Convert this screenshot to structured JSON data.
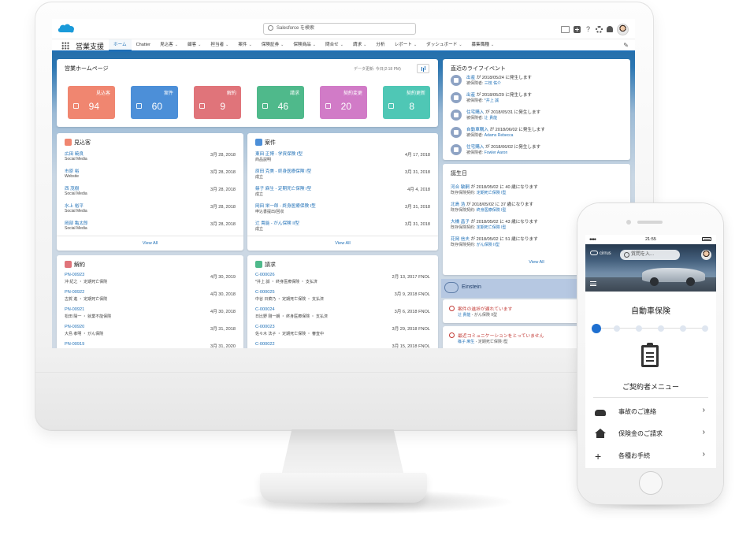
{
  "topbar": {
    "search_placeholder": "Salesforce を検索"
  },
  "nav": {
    "app_name": "営業支援",
    "items": [
      {
        "label": "ホーム",
        "active": true,
        "chevron": false
      },
      {
        "label": "Chatter",
        "active": false,
        "chevron": false
      },
      {
        "label": "見込客",
        "active": false,
        "chevron": true
      },
      {
        "label": "顧客",
        "active": false,
        "chevron": true
      },
      {
        "label": "担当者",
        "active": false,
        "chevron": true
      },
      {
        "label": "案件",
        "active": false,
        "chevron": true
      },
      {
        "label": "保険証券",
        "active": false,
        "chevron": true
      },
      {
        "label": "保険商品",
        "active": false,
        "chevron": true
      },
      {
        "label": "問合せ",
        "active": false,
        "chevron": true
      },
      {
        "label": "請求",
        "active": false,
        "chevron": true
      },
      {
        "label": "分析",
        "active": false,
        "chevron": false
      },
      {
        "label": "レポート",
        "active": false,
        "chevron": true
      },
      {
        "label": "ダッシュボード",
        "active": false,
        "chevron": true
      },
      {
        "label": "募集職種",
        "active": false,
        "chevron": true
      }
    ]
  },
  "home": {
    "title": "営業ホームページ",
    "refresh": "データ更新: 今日(2:18 PM)",
    "tiles": [
      {
        "label": "見込客",
        "value": "94",
        "color": "#f08670"
      },
      {
        "label": "案件",
        "value": "60",
        "color": "#4c8fd8"
      },
      {
        "label": "解約",
        "value": "9",
        "color": "#e0747a"
      },
      {
        "label": "請求",
        "value": "46",
        "color": "#4fb98b"
      },
      {
        "label": "契約変更",
        "value": "20",
        "color": "#d17bc7"
      },
      {
        "label": "契約更新",
        "value": "8",
        "color": "#4fc7b5"
      }
    ]
  },
  "leads": {
    "title": "見込客",
    "icon_color": "#f08670",
    "rows": [
      {
        "name": "広田 暁良",
        "sub": "Social Media",
        "date": "3月 28, 2018"
      },
      {
        "name": "市原 裕",
        "sub": "Website",
        "date": "3月 28, 2018"
      },
      {
        "name": "西 茂樹",
        "sub": "Social Media",
        "date": "3月 28, 2018"
      },
      {
        "name": "水上 裕平",
        "sub": "Social Media",
        "date": "3月 28, 2018"
      },
      {
        "name": "岡部 亀太郎",
        "sub": "Social Media",
        "date": "3月 28, 2018"
      }
    ],
    "view_all": "View All"
  },
  "opps": {
    "title": "案件",
    "icon_color": "#4c8fd8",
    "rows": [
      {
        "name": "東田 正博 - 学資保険 I型",
        "sub": "商品説明",
        "date": "4月 17, 2018"
      },
      {
        "name": "原田 克美 - 終身医療保険 I型",
        "sub": "成立",
        "date": "3月 31, 2018"
      },
      {
        "name": "篠子 麻生 - 定期死亡保険 I型",
        "sub": "成立",
        "date": "4月 4, 2018"
      },
      {
        "name": "岡田 栄一郎 - 終身医療保険 I型",
        "sub": "申込書提出/回収",
        "date": "3月 31, 2018"
      },
      {
        "name": "辻 貴能 - がん保険 II型",
        "sub": "成立",
        "date": "3月 31, 2018"
      }
    ],
    "view_all": "View All"
  },
  "cancels": {
    "title": "解約",
    "icon_color": "#e0747a",
    "rows": [
      {
        "name": "PN-00923",
        "sub": "沖 紀之 ・ 定期死亡保険",
        "date": "4月 30, 2019"
      },
      {
        "name": "PN-00922",
        "sub": "古賀 進 ・ 定期死亡保険",
        "date": "4月 30, 2018"
      },
      {
        "name": "PN-00921",
        "sub": "松田 陽一 ・ 就業不能保険",
        "date": "4月 30, 2018"
      },
      {
        "name": "PN-00920",
        "sub": "大島 孝明 ・ がん保険",
        "date": "3月 31, 2018"
      },
      {
        "name": "PN-00919",
        "sub": "",
        "date": "3月 31, 2020"
      }
    ]
  },
  "claims": {
    "title": "請求",
    "icon_color": "#4fb98b",
    "rows": [
      {
        "name": "C-000026",
        "sub": "*井上 誠 ・ 終身医療保険 ・ 支払済",
        "date": "2月 13, 2017 FNOL"
      },
      {
        "name": "C-000025",
        "sub": "中谷 日菜乃 ・ 定期死亡保険 ・ 支払済",
        "date": "3月 9, 2018 FNOL"
      },
      {
        "name": "C-000024",
        "sub": "日比野 剛一朗 ・ 終身医療保険 ・ 支払済",
        "date": "3月 6, 2018 FNOL"
      },
      {
        "name": "C-000023",
        "sub": "佐々木 法子 ・ 定期死亡保険 ・ 審査中",
        "date": "3月 29, 2018 FNOL"
      },
      {
        "name": "C-000022",
        "sub": "",
        "date": "3月 15, 2018 FNOL"
      }
    ]
  },
  "life_events": {
    "title": "直近のライフイベント",
    "rows": [
      {
        "event": "出産",
        "text": " が 2018/05/24 に発生します",
        "label": "被保険者: ",
        "person": "三枝 佑介"
      },
      {
        "event": "出産",
        "text": " が 2018/05/29 に発生します",
        "label": "被保険者: ",
        "person": "*井上 誠"
      },
      {
        "event": "住宅購入",
        "text": " が 2018/05/31 に発生します",
        "label": "被保険者: ",
        "person": "辻 貴能"
      },
      {
        "event": "自動車購入",
        "text": " が 2018/06/02 に発生します",
        "label": "被保険者: ",
        "person": "Adams Rebecca"
      },
      {
        "event": "住宅購入",
        "text": " が 2018/06/02 に発生します",
        "label": "被保険者: ",
        "person": "Fowler Aaron"
      }
    ]
  },
  "birthdays": {
    "title": "誕生日",
    "rows": [
      {
        "name": "河合 敏嗣",
        "text": " が 2018/05/02 に 40 歳になります",
        "label": "既存保険契約: ",
        "policy": "定期死亡保険 I型"
      },
      {
        "name": "北島 浩",
        "text": " が 2018/05/02 に 37 歳になります",
        "label": "既存保険契約: ",
        "policy": "終身医療保険 I型"
      },
      {
        "name": "大橋 昌子",
        "text": " が 2018/05/02 に 43 歳になります",
        "label": "既存保険契約: ",
        "policy": "定期死亡保険 I型"
      },
      {
        "name": "花岡 信夫",
        "text": " が 2018/05/02 に 51 歳になります",
        "label": "既存保険契約: ",
        "policy": "がん保険 II型"
      }
    ],
    "view_all": "View All"
  },
  "einstein": {
    "title": "Einstein",
    "alerts": [
      {
        "title": "案件の進捗が遅れています",
        "person": "辻 貴能",
        "sep": " - ",
        "detail": "がん保険 II型"
      },
      {
        "title": "最近コミュニケーションをとっていません",
        "person": "篠子 麻生",
        "sep": " - ",
        "detail": "定期死亡保険 I型"
      }
    ]
  },
  "phone": {
    "time": "21:55",
    "brand": "cirrus",
    "search_placeholder": "質問を入...",
    "title": "自動車保険",
    "steps_total": 6,
    "step_active": 1,
    "subtitle": "ご契約者メニュー",
    "menu": [
      {
        "label": "事故のご連絡",
        "icon": "car-icon"
      },
      {
        "label": "保険金のご請求",
        "icon": "home-icon"
      },
      {
        "label": "各種お手続",
        "icon": "plus-icon"
      }
    ]
  }
}
